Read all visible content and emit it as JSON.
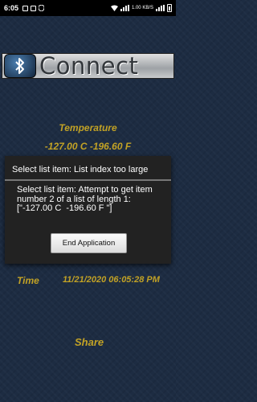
{
  "status_bar": {
    "time": "6:05",
    "network_speed": "1.00 KB/S",
    "icons": [
      "email-icon",
      "calendar-icon",
      "shield-icon",
      "wifi-icon",
      "signal-icon",
      "battery-icon"
    ]
  },
  "banner": {
    "title": "Connect",
    "logo": "bluetooth-icon"
  },
  "temperature": {
    "label": "Temperature",
    "value": "-127.00 C  -196.60 F"
  },
  "timestamp": {
    "label": "Time",
    "value": "11/21/2020 06:05:28 PM"
  },
  "share_label": "Share",
  "dialog": {
    "title": "Select list item: List index too large",
    "message": "Select list item: Attempt to get item number 2 of a list of length 1: [\"-127.00 C  -196.60 F \"]",
    "button_label": "End Application"
  },
  "colors": {
    "background": "#1d2c42",
    "accent": "#c2a225",
    "dialog": "#222222"
  }
}
